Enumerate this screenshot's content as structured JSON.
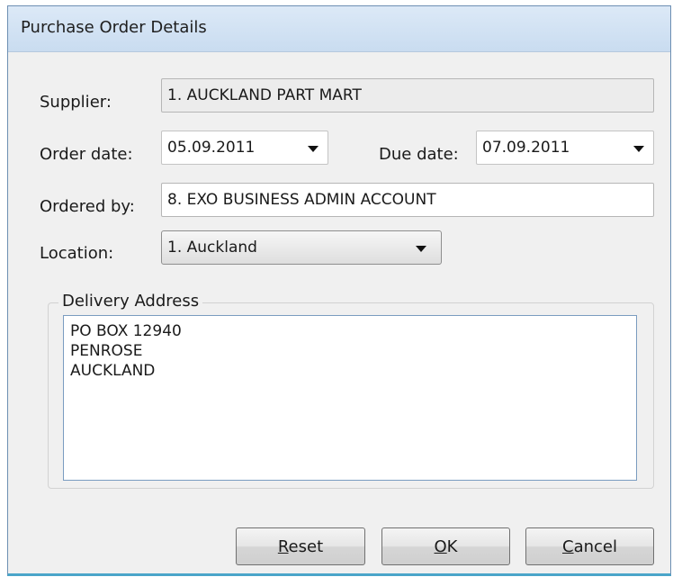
{
  "window": {
    "title": "Purchase Order Details"
  },
  "supplier": {
    "label": "Supplier:",
    "value": "1. AUCKLAND PART MART"
  },
  "order_date": {
    "label": "Order date:",
    "value": "05.09.2011"
  },
  "due_date": {
    "label": "Due date:",
    "value": "07.09.2011"
  },
  "ordered_by": {
    "label": "Ordered by:",
    "value": "8. EXO BUSINESS ADMIN ACCOUNT"
  },
  "location": {
    "label": "Location:",
    "value": "1. Auckland"
  },
  "delivery_address": {
    "legend": "Delivery Address",
    "lines": [
      "PO BOX 12940",
      "PENROSE",
      "AUCKLAND"
    ]
  },
  "buttons": {
    "reset": {
      "mnemonic": "R",
      "rest": "eset"
    },
    "ok": {
      "mnemonic": "O",
      "rest": "K"
    },
    "cancel": {
      "mnemonic": "C",
      "rest": "ancel"
    }
  },
  "colors": {
    "title_bar": "#d4e4f5",
    "dialog_bg": "#f0f0f0",
    "accent_border": "#4aa5c9"
  }
}
